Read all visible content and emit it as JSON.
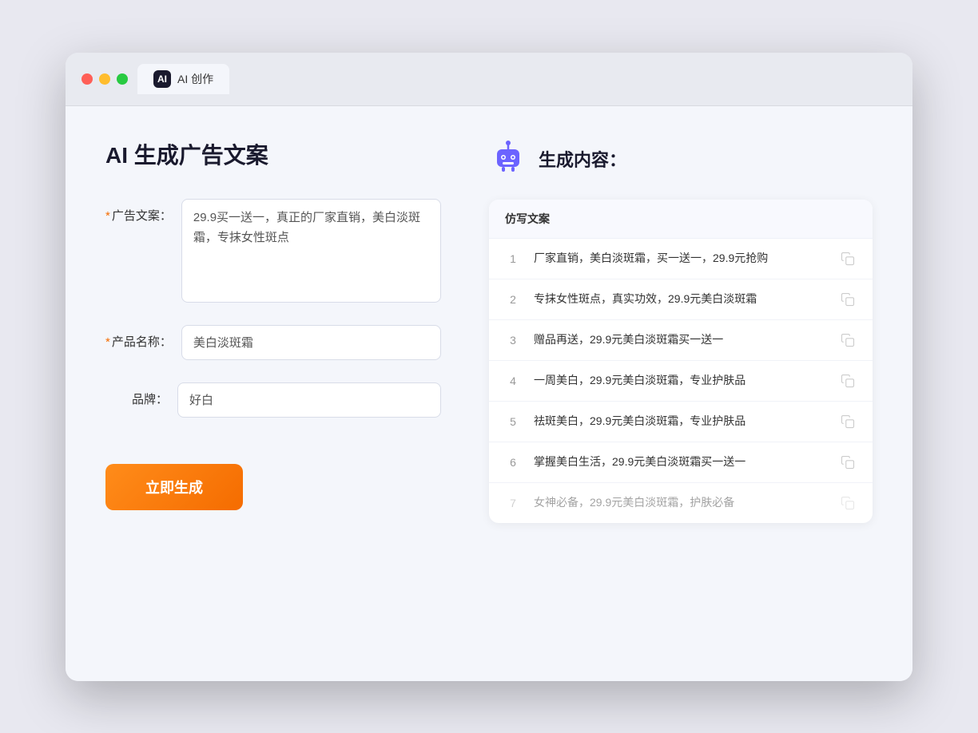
{
  "window": {
    "tab_label": "AI 创作",
    "tab_icon": "AI"
  },
  "left_panel": {
    "title": "AI 生成广告文案",
    "form": {
      "ad_copy_label": "广告文案：",
      "ad_copy_required": true,
      "ad_copy_value": "29.9买一送一，真正的厂家直销，美白淡斑霜，专抹女性斑点",
      "product_name_label": "产品名称：",
      "product_name_required": true,
      "product_name_value": "美白淡斑霜",
      "brand_label": "品牌：",
      "brand_required": false,
      "brand_value": "好白"
    },
    "generate_button": "立即生成"
  },
  "right_panel": {
    "title": "生成内容：",
    "table_header": "仿写文案",
    "rows": [
      {
        "id": 1,
        "text": "厂家直销，美白淡斑霜，买一送一，29.9元抢购",
        "dimmed": false
      },
      {
        "id": 2,
        "text": "专抹女性斑点，真实功效，29.9元美白淡斑霜",
        "dimmed": false
      },
      {
        "id": 3,
        "text": "赠品再送，29.9元美白淡斑霜买一送一",
        "dimmed": false
      },
      {
        "id": 4,
        "text": "一周美白，29.9元美白淡斑霜，专业护肤品",
        "dimmed": false
      },
      {
        "id": 5,
        "text": "祛斑美白，29.9元美白淡斑霜，专业护肤品",
        "dimmed": false
      },
      {
        "id": 6,
        "text": "掌握美白生活，29.9元美白淡斑霜买一送一",
        "dimmed": false
      },
      {
        "id": 7,
        "text": "女神必备，29.9元美白淡斑霜，护肤必备",
        "dimmed": true
      }
    ]
  }
}
